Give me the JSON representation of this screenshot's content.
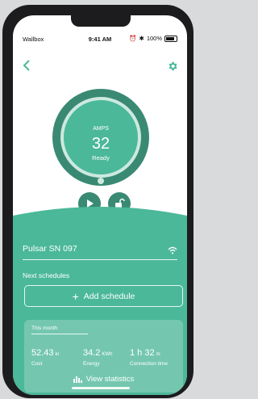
{
  "status_bar": {
    "carrier": "Wallbox",
    "time": "9:41 AM",
    "battery": "100%"
  },
  "charger": {
    "unit": "AMPS",
    "amps": "32",
    "state": "Ready"
  },
  "device": {
    "name": "Pulsar SN 097"
  },
  "schedules": {
    "label": "Next schedules",
    "add_label": "Add schedule"
  },
  "stats": {
    "period": "This month",
    "items": [
      {
        "value": "52.43",
        "unit": "kr",
        "label": "Cost"
      },
      {
        "value": "34.2",
        "unit": "KWh",
        "label": "Energy"
      },
      {
        "value": "1 h 32",
        "unit": "m",
        "label": "Connection time"
      }
    ],
    "view_label": "View statistics"
  },
  "colors": {
    "accent": "#4bb899",
    "dark": "#3a8a73"
  }
}
